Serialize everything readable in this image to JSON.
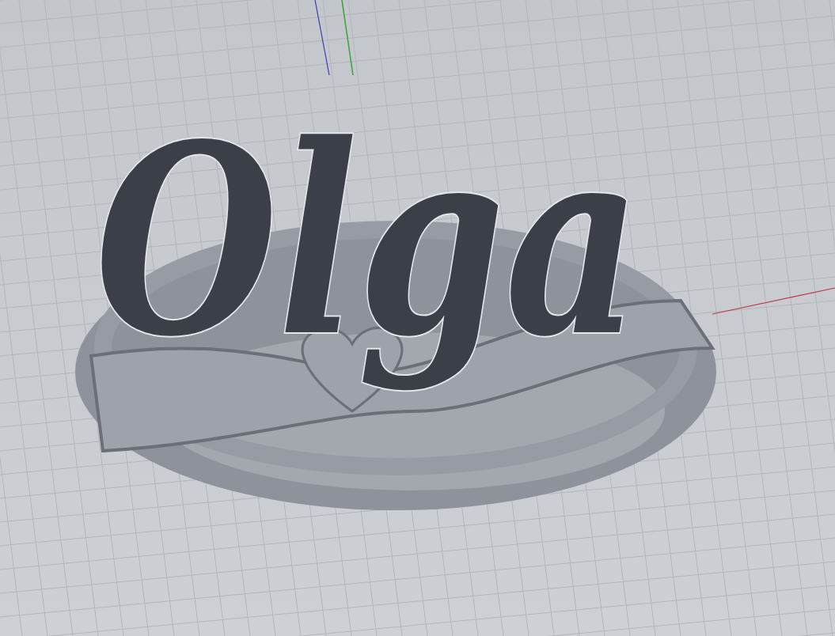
{
  "viewport": {
    "model": {
      "lettering": "Olga"
    }
  }
}
